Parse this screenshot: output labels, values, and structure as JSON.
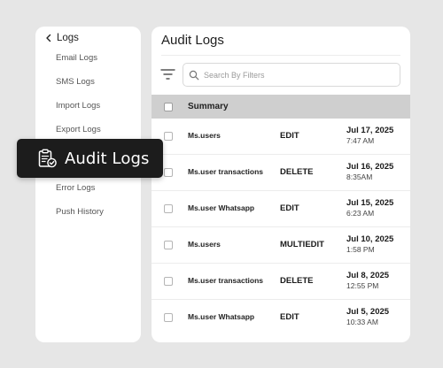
{
  "sidebar": {
    "back_label": "Logs",
    "items": [
      {
        "label": "Email Logs"
      },
      {
        "label": "SMS Logs"
      },
      {
        "label": "Import Logs"
      },
      {
        "label": "Export Logs"
      },
      {
        "label": "Error Logs"
      },
      {
        "label": "Push History"
      }
    ]
  },
  "highlight": {
    "label": "Audit Logs",
    "icon": "clipboard-check-icon"
  },
  "main": {
    "title": "Audit Logs",
    "search": {
      "placeholder": "Search By Filters"
    },
    "table": {
      "header": "Summary",
      "rows": [
        {
          "name": "Ms.users",
          "action": "EDIT",
          "date": "Jul 17, 2025",
          "time": "7:47 AM"
        },
        {
          "name": "Ms.user transactions",
          "action": "DELETE",
          "date": "Jul 16, 2025",
          "time": "8:35AM"
        },
        {
          "name": "Ms.user Whatsapp",
          "action": "EDIT",
          "date": "Jul 15, 2025",
          "time": "6:23 AM"
        },
        {
          "name": "Ms.users",
          "action": "MULTIEDIT",
          "date": "Jul 10, 2025",
          "time": "1:58 PM"
        },
        {
          "name": "Ms.user transactions",
          "action": "DELETE",
          "date": "Jul 8, 2025",
          "time": "12:55 PM"
        },
        {
          "name": "Ms.user Whatsapp",
          "action": "EDIT",
          "date": "Jul 5, 2025",
          "time": "10:33 AM"
        }
      ]
    }
  }
}
